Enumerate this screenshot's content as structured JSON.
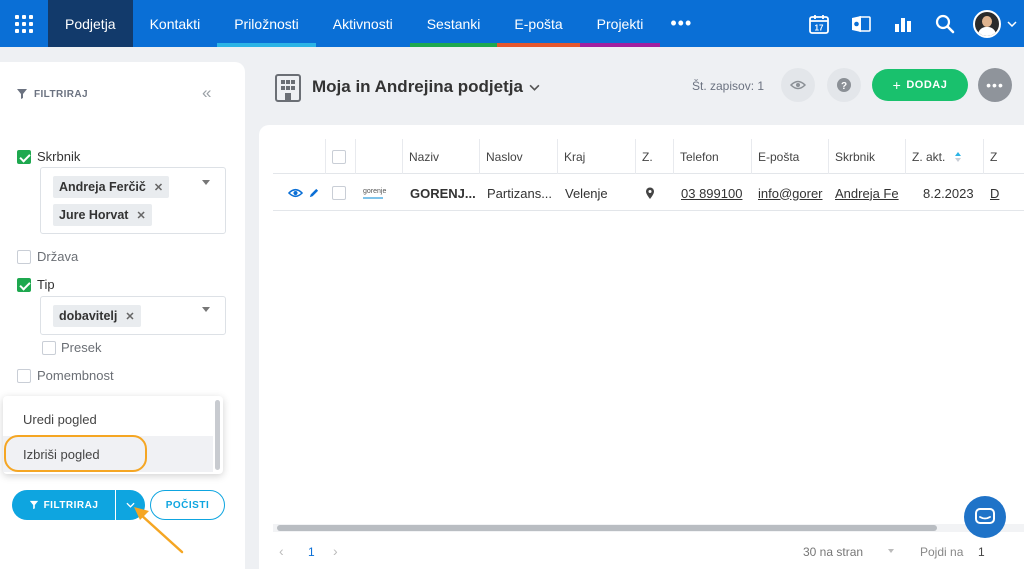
{
  "nav": {
    "items": [
      {
        "label": "Podjetja",
        "active": true,
        "color": ""
      },
      {
        "label": "Kontakti",
        "active": false,
        "color": ""
      },
      {
        "label": "Priložnosti",
        "active": false,
        "color": "#2bb4e6"
      },
      {
        "label": "Aktivnosti",
        "active": false,
        "color": ""
      },
      {
        "label": "Sestanki",
        "active": false,
        "color": "#1ea84f"
      },
      {
        "label": "E-pošta",
        "active": false,
        "color": "#e4572e"
      },
      {
        "label": "Projekti",
        "active": false,
        "color": "#a020a0"
      }
    ],
    "more": "•••",
    "calendar_day": "17"
  },
  "filter": {
    "title": "FILTRIRAJ",
    "fields": {
      "skrbnik": {
        "label": "Skrbnik",
        "checked": true,
        "tags": [
          "Andreja Ferčič",
          "Jure Horvat"
        ]
      },
      "drzava": {
        "label": "Država",
        "checked": false
      },
      "tip": {
        "label": "Tip",
        "checked": true,
        "tags": [
          "dobavitelj"
        ],
        "presek": "Presek"
      },
      "pomembnost": {
        "label": "Pomembnost",
        "checked": false
      }
    },
    "menu": {
      "edit": "Uredi pogled",
      "delete": "Izbriši pogled"
    },
    "filter_button": "FILTRIRAJ",
    "clear_button": "POČISTI"
  },
  "view": {
    "title": "Moja in Andrejina podjetja",
    "record_count": "Št. zapisov: 1",
    "add_button": "DODAJ"
  },
  "table": {
    "columns": [
      "Naziv",
      "Naslov",
      "Kraj",
      "Z.",
      "Telefon",
      "E-pošta",
      "Skrbnik",
      "Z. akt.",
      "Z"
    ],
    "rows": [
      {
        "logo_text": "gorenje",
        "naziv": "GORENJ...",
        "naslov": "Partizans...",
        "kraj": "Velenje",
        "telefon": "03 899100",
        "eposta": "info@gorer",
        "skrbnik": "Andreja Fe",
        "zakt": "8.2.2023",
        "z": "D"
      }
    ]
  },
  "pager": {
    "page": "1",
    "per_page": "30 na stran",
    "goto_label": "Pojdi na",
    "goto_value": "1"
  },
  "colors": {
    "nav_bg": "#0a6fd6",
    "accent": "#0ea5e0",
    "add_green": "#19c16d",
    "highlight": "#f5a623"
  }
}
